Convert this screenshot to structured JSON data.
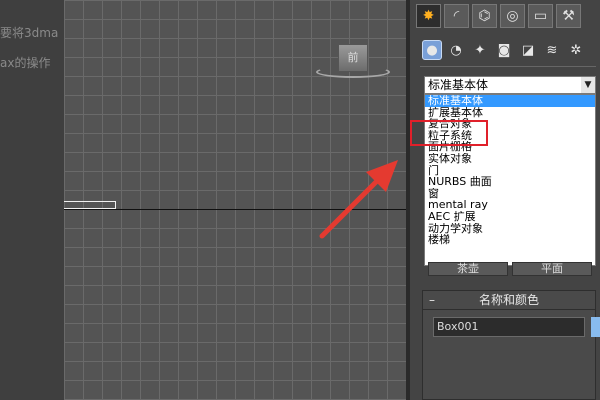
{
  "left_text": [
    "要将3dma",
    "ax的操作"
  ],
  "viewport": {
    "viewcube_label": "前"
  },
  "command_panel": {
    "tabs": [
      {
        "name": "create-tab",
        "glyph": "✸",
        "active": true
      },
      {
        "name": "modify-tab",
        "glyph": "◜",
        "active": false
      },
      {
        "name": "hierarchy-tab",
        "glyph": "⌬",
        "active": false
      },
      {
        "name": "motion-tab",
        "glyph": "◎",
        "active": false
      },
      {
        "name": "display-tab",
        "glyph": "▭",
        "active": false
      },
      {
        "name": "utilities-tab",
        "glyph": "⚒",
        "active": false
      }
    ],
    "type_tabs": [
      {
        "name": "geometry-icon",
        "glyph": "●",
        "active": true
      },
      {
        "name": "shapes-icon",
        "glyph": "◔",
        "active": false
      },
      {
        "name": "lights-icon",
        "glyph": "✦",
        "active": false
      },
      {
        "name": "cameras-icon",
        "glyph": "◙",
        "active": false
      },
      {
        "name": "helpers-icon",
        "glyph": "◪",
        "active": false
      },
      {
        "name": "spacewarps-icon",
        "glyph": "≋",
        "active": false
      },
      {
        "name": "systems-icon",
        "glyph": "✲",
        "active": false
      }
    ],
    "category_select": {
      "value": "标准基本体"
    },
    "dropdown_options": [
      {
        "label": "标准基本体",
        "selected": true
      },
      {
        "label": "扩展基本体",
        "selected": false
      },
      {
        "label": "复合对象",
        "selected": false
      },
      {
        "label": "粒子系统",
        "selected": false
      },
      {
        "label": "面片栅格",
        "selected": false
      },
      {
        "label": "实体对象",
        "selected": false
      },
      {
        "label": "门",
        "selected": false
      },
      {
        "label": "NURBS 曲面",
        "selected": false
      },
      {
        "label": "窗",
        "selected": false
      },
      {
        "label": "mental ray",
        "selected": false
      },
      {
        "label": "AEC 扩展",
        "selected": false
      },
      {
        "label": "动力学对象",
        "selected": false
      },
      {
        "label": "楼梯",
        "selected": false
      }
    ],
    "object_buttons": [
      "茶壶",
      "平面"
    ],
    "name_color": {
      "title": "名称和颜色",
      "collapse": "–",
      "object_name": "Box001",
      "swatch_color": "#88bbee"
    }
  },
  "annotation": {
    "highlight_color": "#e0202a"
  }
}
